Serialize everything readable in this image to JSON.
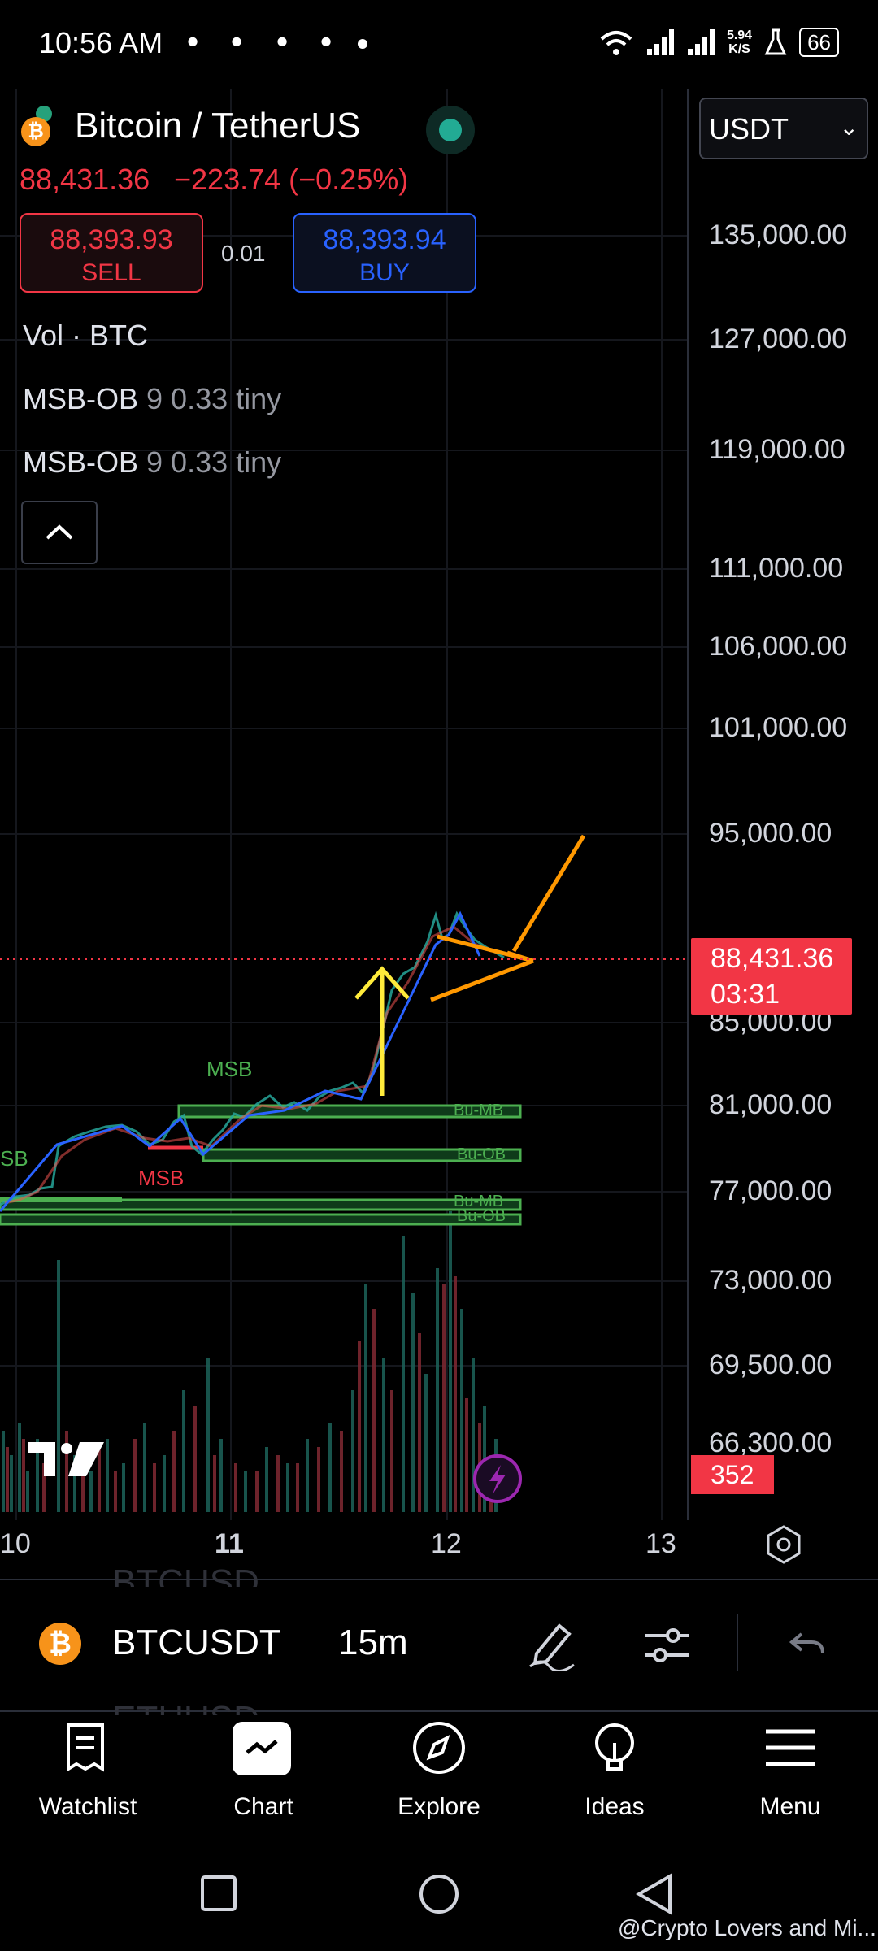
{
  "status_bar": {
    "time": "10:56 AM",
    "net_speed_value": "5.94",
    "net_speed_unit": "K/S",
    "battery": "66"
  },
  "header": {
    "title": "Bitcoin / TetherUS",
    "price": "88,431.36",
    "change": "−223.74 (−0.25%)",
    "sell_price": "88,393.93",
    "sell_label": "SELL",
    "buy_price": "88,393.94",
    "buy_label": "BUY",
    "spread": "0.01"
  },
  "indicators": [
    {
      "name": "Vol · BTC",
      "params": ""
    },
    {
      "name": "MSB-OB",
      "params": "9 0.33 tiny"
    },
    {
      "name": "MSB-OB",
      "params": "9 0.33 tiny"
    }
  ],
  "currency": {
    "selected": "USDT"
  },
  "price_axis": {
    "ticks": [
      "135,000.00",
      "127,000.00",
      "119,000.00",
      "111,000.00",
      "106,000.00",
      "101,000.00",
      "95,000.00",
      "85,000.00",
      "81,000.00",
      "77,000.00",
      "73,000.00",
      "69,500.00",
      "66,300.00"
    ],
    "current_price": "88,431.36",
    "countdown": "03:31",
    "volume_label": "352"
  },
  "time_axis": {
    "ticks": [
      "10",
      "11",
      "12",
      "13"
    ]
  },
  "chart_annotations": {
    "msb_green_1": "MSB",
    "msb_green_2": "SB",
    "msb_red": "MSB",
    "bu_mb_1": "Bu-MB",
    "bu_ob_1": "Bu-OB",
    "bu_mb_2": "Bu-MB",
    "bu_ob_2": "Bu-OB"
  },
  "toolbar": {
    "symbol": "BTCUSDT",
    "interval": "15m",
    "ghost_prev": "BTCUSD",
    "ghost_next": "ETHUSD"
  },
  "bottom_nav": {
    "items": [
      "Watchlist",
      "Chart",
      "Explore",
      "Ideas",
      "Menu"
    ]
  },
  "watermark": "@Crypto Lovers and Mi...",
  "colors": {
    "bear": "#f23645",
    "bull": "#22ab94",
    "accent_blue": "#2962ff",
    "ob_green": "#4caf50",
    "pattern_orange": "#ff9800",
    "arrow_yellow": "#ffeb3b"
  }
}
